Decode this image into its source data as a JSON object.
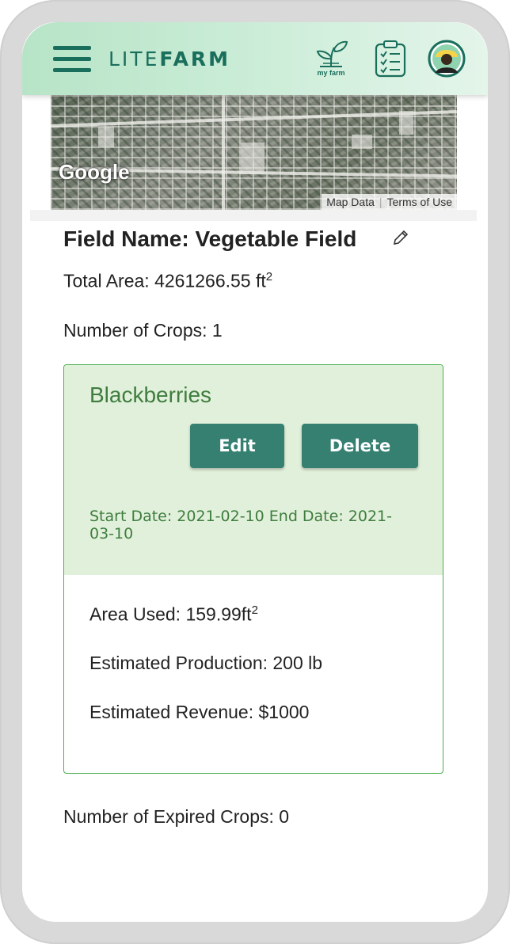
{
  "header": {
    "brand_light": "LITE",
    "brand_bold": "FARM",
    "my_farm_label": "my farm"
  },
  "map": {
    "provider_logo": "Google",
    "map_data_link": "Map Data",
    "terms_link": "Terms of Use"
  },
  "field": {
    "title": "Field Name: Vegetable Field",
    "total_area_text": "Total Area: 4261266.55 ft",
    "total_area_sup": "2",
    "num_crops_text": "Number of Crops: 1",
    "num_expired_text": "Number of Expired Crops: 0"
  },
  "crop": {
    "name": "Blackberries",
    "edit_label": "Edit",
    "delete_label": "Delete",
    "dates_line1": "Start Date: 2021-02-10 End Date: 2021-",
    "dates_line2": "03-10",
    "area_used_text": "Area Used: 159.99ft",
    "area_used_sup": "2",
    "production_text": "Estimated Production: 200 lb",
    "revenue_text": "Estimated Revenue: $1000"
  },
  "colors": {
    "brand": "#1a6e5c",
    "button": "#368072",
    "card_header": "#e1f0da",
    "crop_name": "#3f7d3f",
    "card_border": "#4caf50"
  },
  "icons": {
    "menu": "hamburger-menu-icon",
    "my_farm": "sprout-icon",
    "tasks": "clipboard-checklist-icon",
    "profile": "avatar-icon",
    "edit_field": "pencil-icon"
  }
}
